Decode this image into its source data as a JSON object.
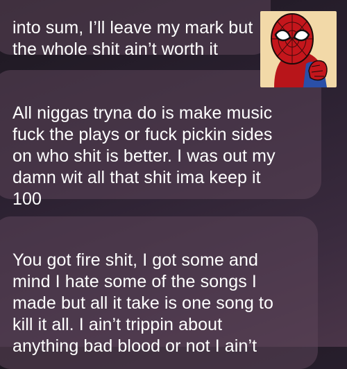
{
  "messages": [
    {
      "text": "into sum, I’ll leave my mark but\nthe whole shit ain’t worth it"
    },
    {
      "text": "All niggas tryna do is make music\nfuck the plays or fuck pickin sides\non who shit is better. I was out my\ndamn wit all that shit ima keep it\n100"
    },
    {
      "text": "You got fire shit, I got some and\nmind I hate some of the songs I\nmade but all it take is one song to\nkill it all. I ain’t trippin about\nanything bad blood or not I ain’t"
    }
  ],
  "avatar": {
    "icon": "spiderman-avatar-icon"
  },
  "colors": {
    "background_top": "#1d1820",
    "background_bottom": "#4a3548",
    "bubble": "#5c465a",
    "text": "#ffffff"
  }
}
